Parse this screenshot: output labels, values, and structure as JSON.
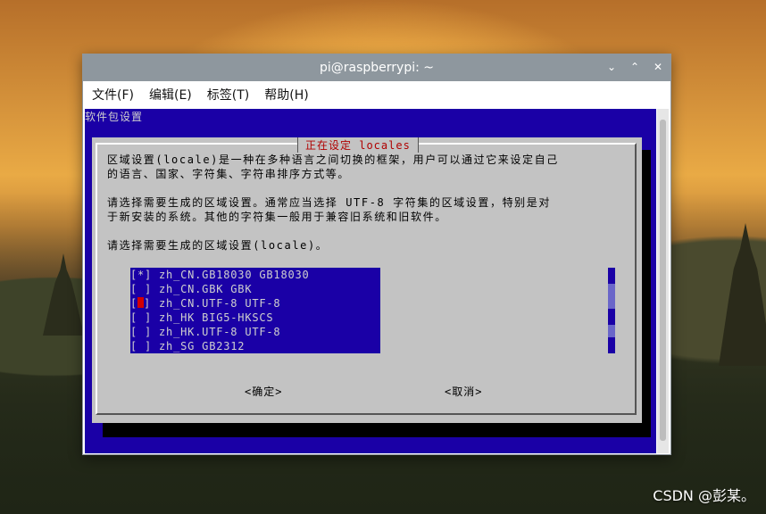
{
  "window": {
    "title": "pi@raspberrypi: ~",
    "controls": [
      "⌄",
      "⌃",
      "✕"
    ]
  },
  "menubar": {
    "items": [
      "文件(F)",
      "编辑(E)",
      "标签(T)",
      "帮助(H)"
    ]
  },
  "terminal": {
    "backtitle": "软件包设置",
    "dialog": {
      "title": "正在设定 locales",
      "lines": [
        "区域设置(locale)是一种在多种语言之间切换的框架，用户可以通过它来设定自己",
        "的语言、国家、字符集、字符串排序方式等。",
        "",
        "请选择需要生成的区域设置。通常应当选择 UTF-8 字符集的区域设置，特别是对",
        "于新安装的系统。其他的字符集一般用于兼容旧系统和旧软件。",
        "",
        "请选择需要生成的区域设置(locale)。"
      ],
      "options": [
        {
          "check": "[*]",
          "label": "zh_CN.GB18030 GB18030"
        },
        {
          "check": "[ ]",
          "label": "zh_CN.GBK GBK"
        },
        {
          "check": "[ ]",
          "label": "zh_CN.UTF-8 UTF-8"
        },
        {
          "check": "[ ]",
          "label": "zh_HK BIG5-HKSCS"
        },
        {
          "check": "[ ]",
          "label": "zh_HK.UTF-8 UTF-8"
        },
        {
          "check": "[ ]",
          "label": "zh_SG GB2312"
        }
      ],
      "ok_label": "<确定>",
      "cancel_label": "<取消>"
    }
  },
  "watermark": "CSDN @彭某。",
  "colors": {
    "terminal_bg": "#1a00a6",
    "dialog_bg": "#c3c3c3",
    "title_red": "#b00000",
    "cursor_red": "#d20000",
    "titlebar": "#8e979e"
  }
}
